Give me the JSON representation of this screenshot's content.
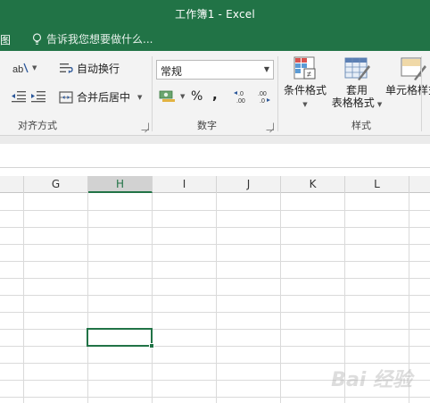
{
  "window": {
    "title": "工作簿1 - Excel"
  },
  "tabs": {
    "partial_tab": "图",
    "tell_me_placeholder": "告诉我您想要做什么..."
  },
  "ribbon": {
    "alignment": {
      "wrap_text": "自动换行",
      "merge_center": "合并后居中",
      "group_label": "对齐方式"
    },
    "number": {
      "format_value": "常规",
      "percent": "%",
      "comma": ",",
      "increase_decimal": "←.0\n.00",
      "decrease_decimal": ".00\n→.0",
      "group_label": "数字"
    },
    "styles": {
      "conditional_format": "条件格式",
      "table_format_line1": "套用",
      "table_format_line2": "表格格式",
      "cell_styles": "单元格样式",
      "group_label": "样式"
    }
  },
  "grid": {
    "columns": [
      "G",
      "H",
      "I",
      "J",
      "K",
      "L"
    ],
    "active_column": "H"
  },
  "watermark": "Bai 经验"
}
